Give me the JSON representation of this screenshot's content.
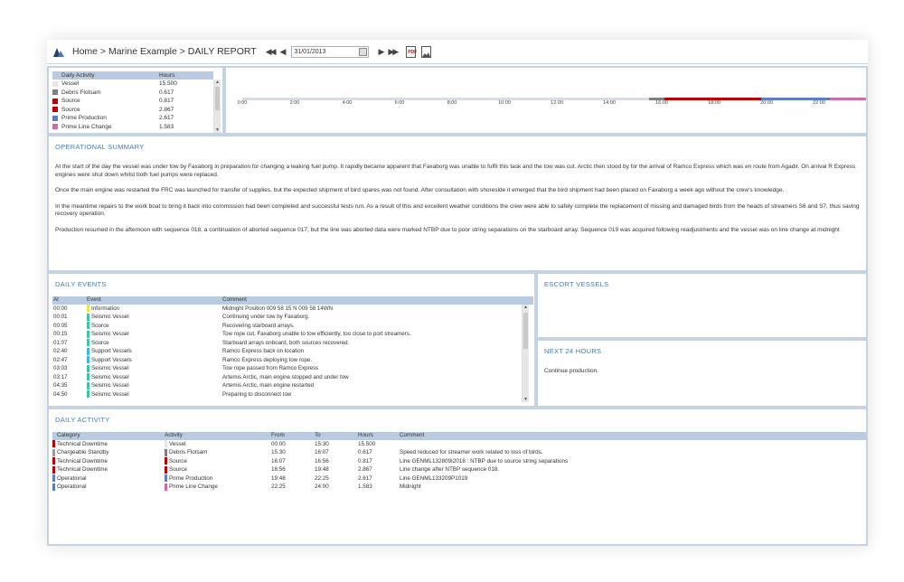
{
  "header": {
    "breadcrumb": "Home > Marine Example > DAILY REPORT",
    "first_btn": "◀◀",
    "prev_btn": "◀",
    "date": "31/01/2013",
    "next_btn": "▶",
    "last_btn": "▶▶",
    "pdf_label": "PDF"
  },
  "activity_mini": {
    "headers": [
      "Daily Activity",
      "Hours"
    ],
    "rows": [
      {
        "label": "Vessel",
        "hours": "15.500",
        "color": "#e6e6e6"
      },
      {
        "label": "Debris Flotsam",
        "hours": "0.617",
        "color": "#808080"
      },
      {
        "label": "Source",
        "hours": "0.817",
        "color": "#c00000"
      },
      {
        "label": "Source",
        "hours": "2.867",
        "color": "#c00000"
      },
      {
        "label": "Prime Production",
        "hours": "2.617",
        "color": "#5b7fc4"
      },
      {
        "label": "Prime Line Change",
        "hours": "1.583",
        "color": "#d06aa8"
      }
    ]
  },
  "timeline": {
    "ticks": [
      "0:00",
      "2:00",
      "4:00",
      "6:00",
      "8:00",
      "10:00",
      "12:00",
      "14:00",
      "16:00",
      "18:00",
      "20:00",
      "22:00"
    ],
    "segments": [
      {
        "start": 0,
        "end": 15.5,
        "color": "#d9dde3"
      },
      {
        "start": 15.5,
        "end": 16.117,
        "color": "#808080"
      },
      {
        "start": 16.117,
        "end": 19.8,
        "color": "#c00000"
      },
      {
        "start": 19.8,
        "end": 22.417,
        "color": "#5b7fc4"
      },
      {
        "start": 22.417,
        "end": 24,
        "color": "#d06aa8"
      }
    ]
  },
  "operational_summary": {
    "title": "OPERATIONAL SUMMARY",
    "paragraphs": [
      "At the start of the day the vessel was under tow by Faxaborg in preparation for changing a leaking fuel pump. It rapidly became apparent that Faxaborg was unable to fulfil this task and the tow was cut. Arctic then stood by for the arrival of Ramco Express which was en route from Agadir. On arrival R Express engines were shut down whilst both fuel pumps were replaced.",
      "Once the main engine was restarted the FRC was launched for transfer of supplies, but the expected shipment of bird spares was not found. After consultation with shoreside it emerged that the bird shipment had been placed on Faxaborg a week ago without the crew's knowledge.",
      "In the meantime repairs to the work boat to bring it back into commission had been completed and successful tests run. As a result of this and excellent weather conditions the crew were able to safely complete the replacement of missing and damaged birds from the heads of streamers S6 and S7, thus saving recovery operation.",
      "Production resumed in the afternoon with sequence 018, a continuation of aborted sequence 017, but the line was aborted data were marked NTBP due to poor string separations on the starboard array. Sequence 019 was acquired following readjustments and the vessel was on line change at midnight"
    ]
  },
  "daily_events": {
    "title": "DAILY EVENTS",
    "headers": [
      "At",
      "Event",
      "Comment"
    ],
    "rows": [
      {
        "at": "00:00",
        "event": "Information",
        "comment": "Midnight Position 009 58 15 N 009 58 14WN",
        "color": "#e8e84a"
      },
      {
        "at": "00:01",
        "event": "Seismic Vessel",
        "comment": "Continuing under tow by Faxaborg.",
        "color": "#3cc8a0"
      },
      {
        "at": "00:05",
        "event": "Source",
        "comment": "Recovering starboard arrays.",
        "color": "#3cc8a0"
      },
      {
        "at": "00:15",
        "event": "Seismic Vessel",
        "comment": "Tow rope cut, Faxaborg unable to tow efficiently, too close to port streamers.",
        "color": "#3cc8a0"
      },
      {
        "at": "01:07",
        "event": "Source",
        "comment": "Starboard arrays onboard, both sources recovered.",
        "color": "#3cc8a0"
      },
      {
        "at": "02:40",
        "event": "Support Vessels",
        "comment": "Ramco Express back on location",
        "color": "#3cb4e6"
      },
      {
        "at": "02:47",
        "event": "Support Vessels",
        "comment": "Ramco Express deploying tow rope.",
        "color": "#3cb4e6"
      },
      {
        "at": "03:03",
        "event": "Seismic Vessel",
        "comment": "Tow rope passed from Ramco Express",
        "color": "#3cc8a0"
      },
      {
        "at": "03:17",
        "event": "Seismic Vessel",
        "comment": "Artemis Arctic, main engine stopped and under tow",
        "color": "#3cc8a0"
      },
      {
        "at": "04:35",
        "event": "Seismic Vessel",
        "comment": "Artemis Arctic, main engine restarted",
        "color": "#3cc8a0"
      },
      {
        "at": "04:50",
        "event": "Seismic Vessel",
        "comment": "Preparing to disconnect tow",
        "color": "#3cc8a0"
      }
    ]
  },
  "escort_vessels": {
    "title": "ESCORT VESSELS"
  },
  "next_24": {
    "title": "NEXT 24 HOURS",
    "text": "Continue production."
  },
  "daily_activity": {
    "title": "DAILY ACTIVITY",
    "headers": [
      "Category",
      "Activity",
      "From",
      "To",
      "Hours",
      "Comment"
    ],
    "rows": [
      {
        "category": "Technical Downtime",
        "cat_color": "#c00000",
        "activity": "Vessel",
        "act_color": "#e6e6e6",
        "from": "00:00",
        "to": "15:30",
        "hours": "15.500",
        "comment": ""
      },
      {
        "category": "Chargeable Standby",
        "cat_color": "#9a9a9a",
        "activity": "Debris Flotsam",
        "act_color": "#808080",
        "from": "15:30",
        "to": "16:07",
        "hours": "0.617",
        "comment": "Speed reduced for streamer work related to loss of birds."
      },
      {
        "category": "Technical Downtime",
        "cat_color": "#c00000",
        "activity": "Source",
        "act_color": "#c00000",
        "from": "16:07",
        "to": "16:56",
        "hours": "0.817",
        "comment": "Line GENML132809I2018 : NTBP due to source string separations"
      },
      {
        "category": "Technical Downtime",
        "cat_color": "#c00000",
        "activity": "Source",
        "act_color": "#c00000",
        "from": "16:56",
        "to": "19:48",
        "hours": "2.867",
        "comment": "Line change after NTBP sequence 018."
      },
      {
        "category": "Operational",
        "cat_color": "#5b7fc4",
        "activity": "Prime Production",
        "act_color": "#5b7fc4",
        "from": "19:48",
        "to": "22:25",
        "hours": "2.617",
        "comment": "Line GENML133209P1019"
      },
      {
        "category": "Operational",
        "cat_color": "#5b7fc4",
        "activity": "Prime Line Change",
        "act_color": "#d06aa8",
        "from": "22:25",
        "to": "24:00",
        "hours": "1.583",
        "comment": "Midnight"
      }
    ]
  }
}
